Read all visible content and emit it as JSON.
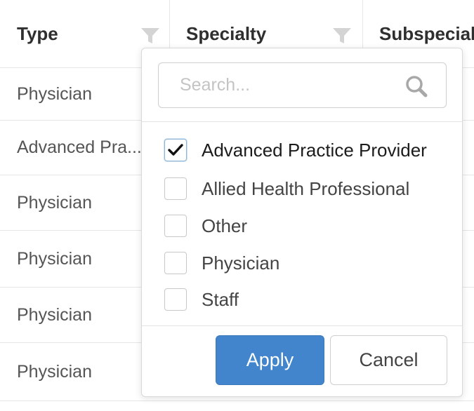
{
  "table": {
    "columns": [
      {
        "label": "Type",
        "icon": "filter-icon"
      },
      {
        "label": "Specialty",
        "icon": "filter-icon"
      },
      {
        "label": "Subspecialty"
      }
    ],
    "rows": [
      {
        "type": "Physician"
      },
      {
        "type": "Advanced Pra..."
      },
      {
        "type": "Physician"
      },
      {
        "type": "Physician"
      },
      {
        "type": "Physician"
      },
      {
        "type": "Physician"
      }
    ]
  },
  "filter_popup": {
    "search_placeholder": "Search...",
    "search_value": "",
    "search_icon": "magnifier-icon",
    "options": [
      {
        "label": "Advanced Practice Provider",
        "checked": true
      },
      {
        "label": "Allied Health Professional",
        "checked": false
      },
      {
        "label": "Other",
        "checked": false
      },
      {
        "label": "Physician",
        "checked": false
      },
      {
        "label": "Staff",
        "checked": false
      }
    ],
    "apply_label": "Apply",
    "cancel_label": "Cancel"
  },
  "colors": {
    "accent": "#4285cc",
    "filter_icon": "#d4d4d4",
    "border": "#e6e6e6"
  }
}
